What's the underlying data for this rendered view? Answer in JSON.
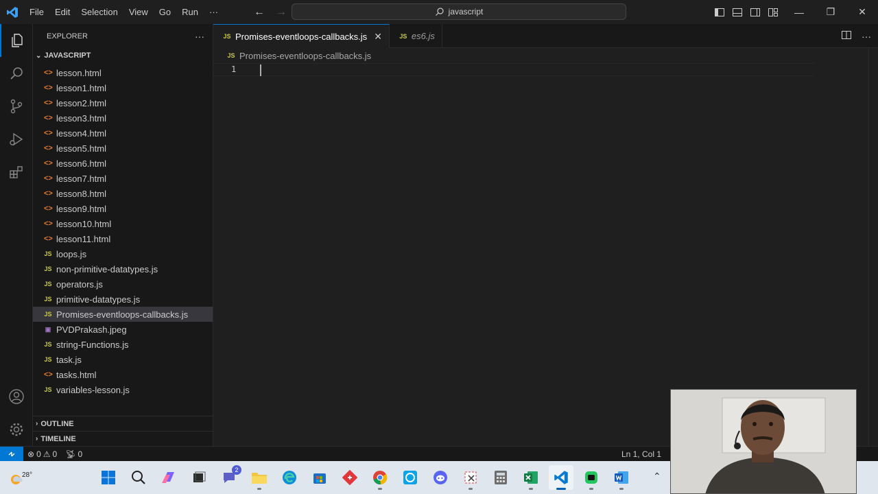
{
  "menu": [
    "File",
    "Edit",
    "Selection",
    "View",
    "Go",
    "Run",
    "···"
  ],
  "search": {
    "text": "javascript"
  },
  "sidebar": {
    "title": "EXPLORER",
    "more": "···",
    "folder": "JAVASCRIPT",
    "files": [
      {
        "name": "lesson.html",
        "type": "html"
      },
      {
        "name": "lesson1.html",
        "type": "html"
      },
      {
        "name": "lesson2.html",
        "type": "html"
      },
      {
        "name": "lesson3.html",
        "type": "html"
      },
      {
        "name": "lesson4.html",
        "type": "html"
      },
      {
        "name": "lesson5.html",
        "type": "html"
      },
      {
        "name": "lesson6.html",
        "type": "html"
      },
      {
        "name": "lesson7.html",
        "type": "html"
      },
      {
        "name": "lesson8.html",
        "type": "html"
      },
      {
        "name": "lesson9.html",
        "type": "html"
      },
      {
        "name": "lesson10.html",
        "type": "html"
      },
      {
        "name": "lesson11.html",
        "type": "html"
      },
      {
        "name": "loops.js",
        "type": "js"
      },
      {
        "name": "non-primitive-datatypes.js",
        "type": "js"
      },
      {
        "name": "operators.js",
        "type": "js"
      },
      {
        "name": "primitive-datatypes.js",
        "type": "js"
      },
      {
        "name": "Promises-eventloops-callbacks.js",
        "type": "js",
        "selected": true
      },
      {
        "name": "PVDPrakash.jpeg",
        "type": "img"
      },
      {
        "name": "string-Functions.js",
        "type": "js"
      },
      {
        "name": "task.js",
        "type": "js"
      },
      {
        "name": "tasks.html",
        "type": "html"
      },
      {
        "name": "variables-lesson.js",
        "type": "js"
      }
    ],
    "outline": "OUTLINE",
    "timeline": "TIMELINE"
  },
  "tabs": [
    {
      "label": "Promises-eventloops-callbacks.js",
      "active": true,
      "close": "✕"
    },
    {
      "label": "es6.js",
      "active": false
    }
  ],
  "editor": {
    "breadcrumb": "Promises-eventloops-callbacks.js",
    "line_number": "1"
  },
  "status": {
    "errors": "0",
    "warnings": "0",
    "ports": "0",
    "position": "Ln 1, Col 1"
  },
  "taskbar": {
    "temperature": "28°",
    "chat_badge": "2"
  },
  "file_icon_glyphs": {
    "html": "<>",
    "js": "JS",
    "img": "▣"
  },
  "colors": {
    "accent": "#0078d4",
    "html_icon": "#e37933",
    "js_icon": "#cbcb41"
  }
}
